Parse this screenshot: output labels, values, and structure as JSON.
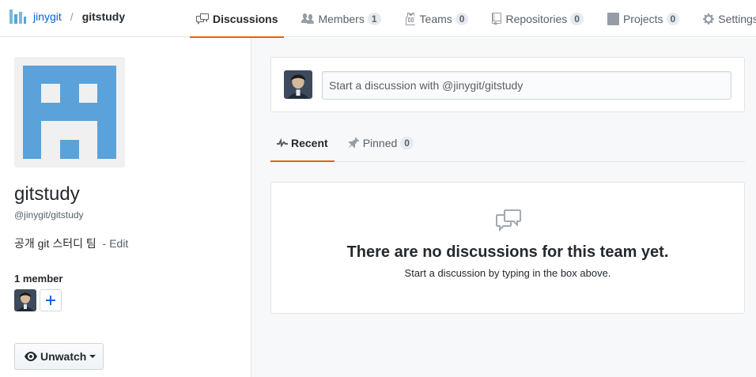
{
  "header": {
    "org_name": "jinygit",
    "separator": "/",
    "team_name": "gitstudy"
  },
  "tabs": [
    {
      "label": "Discussions",
      "icon": "comment-discussion-icon",
      "active": true
    },
    {
      "label": "Members",
      "icon": "people-icon",
      "count": "1"
    },
    {
      "label": "Teams",
      "icon": "jersey-icon",
      "count": "0"
    },
    {
      "label": "Repositories",
      "icon": "repo-icon",
      "count": "0"
    },
    {
      "label": "Projects",
      "icon": "project-icon",
      "count": "0"
    },
    {
      "label": "Settings",
      "icon": "gear-icon"
    }
  ],
  "sidebar": {
    "team_name": "gitstudy",
    "handle": "@jinygit/gitstudy",
    "description": "공개 git 스터디 팀",
    "edit_label": "- Edit",
    "member_count_label": "1 member",
    "unwatch_label": "Unwatch"
  },
  "composer": {
    "placeholder": "Start a discussion with @jinygit/gitstudy"
  },
  "subtabs": [
    {
      "label": "Recent",
      "icon": "pulse-icon",
      "active": true
    },
    {
      "label": "Pinned",
      "icon": "pin-icon",
      "count": "0"
    }
  ],
  "blankslate": {
    "icon": "comment-discussion-icon",
    "title": "There are no discussions for this team yet.",
    "description": "Start a discussion by typing in the box above."
  },
  "colors": {
    "link": "#0366d6",
    "active_underline": "#e36209",
    "identicon": "#5aa2d9"
  }
}
